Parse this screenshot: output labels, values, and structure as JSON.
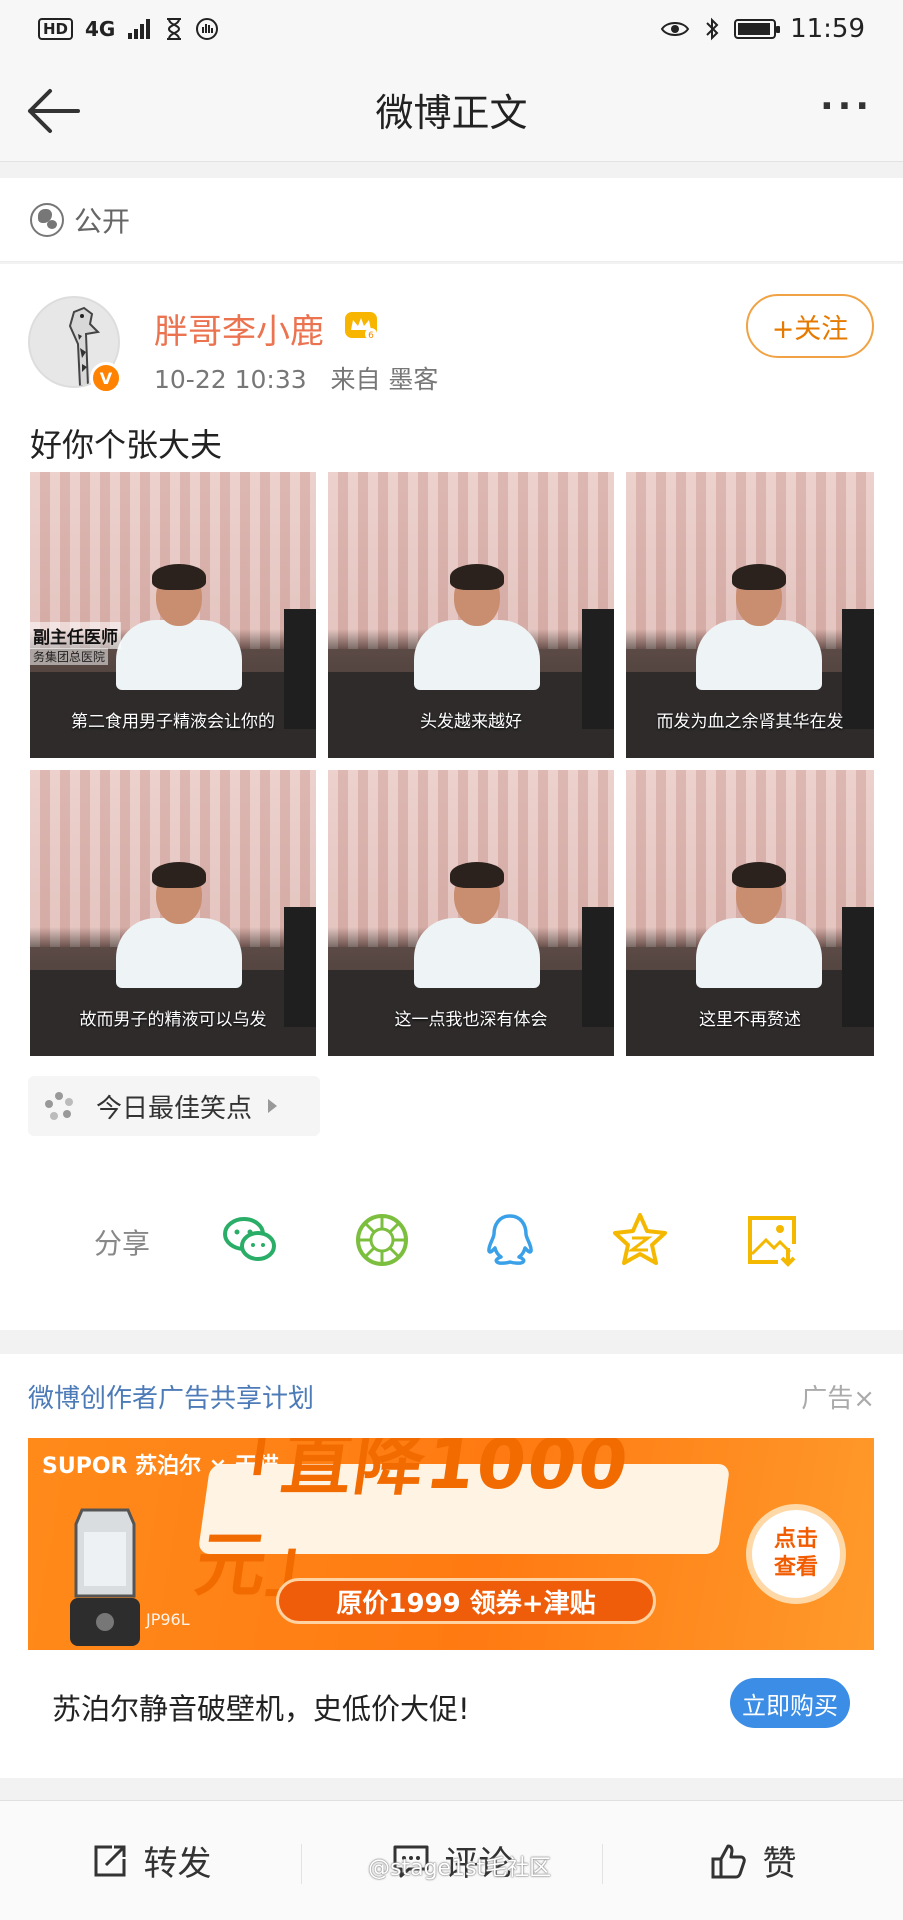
{
  "status_bar": {
    "hd": "HD",
    "network": "4G",
    "time": "11:59",
    "battery_level": 0.85
  },
  "nav": {
    "title": "微博正文"
  },
  "visibility": {
    "label": "公开"
  },
  "post": {
    "user_name": "胖哥李小鹿",
    "verified_badge": "V",
    "meta": "10-22 10:33   来自 墨客",
    "follow_label": "+关注",
    "text": "好你个张大夫",
    "photos": [
      {
        "caption": "第二食用男子精液会让你的",
        "side_label": "副主任医师",
        "side_label2": "务集团总医院"
      },
      {
        "caption": "头发越来越好"
      },
      {
        "caption": "而发为血之余肾其华在发"
      },
      {
        "caption": "故而男子的精液可以乌发"
      },
      {
        "caption": "这一点我也深有体会"
      },
      {
        "caption": "这里不再赘述"
      }
    ],
    "topic": "今日最佳笑点",
    "share_label": "分享",
    "share_icons": [
      "wechat-icon",
      "moments-icon",
      "qq-icon",
      "qzone-icon",
      "save-image-icon"
    ]
  },
  "ad": {
    "header": "微博创作者广告共享计划",
    "label": "广告×",
    "brand": "SUPOR 苏泊尔 × 天猫",
    "headline": "「直降1000元」",
    "subline": "原价1999 领券+津贴",
    "cta_circle_line1": "点击",
    "cta_circle_line2": "查看",
    "model": "JP96L",
    "title": "苏泊尔静音破壁机，史低价大促!",
    "button": "立即购买"
  },
  "bottom_bar": {
    "repost": "转发",
    "comment": "评论",
    "like": "赞"
  },
  "watermark": "@stage1st毛社区",
  "colors": {
    "accent_orange": "#eb7350",
    "link_blue": "#4c7bb8",
    "button_blue": "#3b8de5",
    "wechat_green": "#2aae67",
    "qq_blue": "#3aa0e8",
    "qzone_yellow": "#f5b800"
  }
}
